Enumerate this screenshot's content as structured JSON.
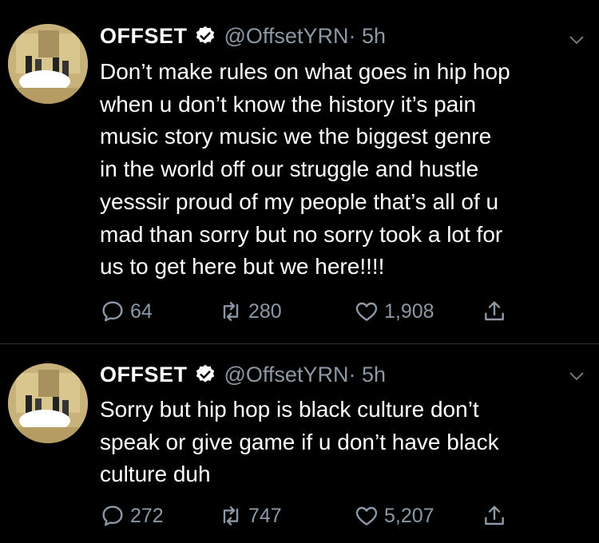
{
  "tweets": [
    {
      "name": "OFFSET",
      "handle": "@OffsetYRN",
      "time": " · 5h",
      "text": "Don’t make rules on what goes in hip hop\nwhen u don’t know the history it’s pain\nmusic story music we the biggest genre\nin the world off our struggle and hustle\nyesssir proud of my people that’s all of u\nmad than sorry but no sorry took a lot for\nus to get here but we here!!!!",
      "replies": "64",
      "retweets": "280",
      "likes": "1,908"
    },
    {
      "name": "OFFSET",
      "handle": "@OffsetYRN",
      "time": " · 5h",
      "text": "Sorry but hip hop is black culture don’t\nspeak or give game if u don’t have black\nculture duh",
      "replies": "272",
      "retweets": "747",
      "likes": "5,207"
    }
  ],
  "icons": {
    "verified": "verified-badge-icon",
    "caret": "chevron-down-icon",
    "reply": "reply-icon",
    "retweet": "retweet-icon",
    "like": "heart-icon",
    "share": "share-icon"
  },
  "colors": {
    "background": "#000000",
    "text": "#ffffff",
    "muted": "#8b98a5",
    "divider": "#2f3336"
  }
}
